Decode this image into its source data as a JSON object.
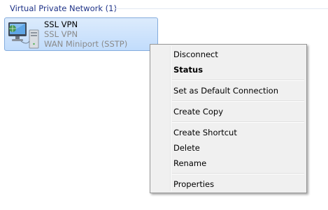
{
  "group": {
    "title": "Virtual Private Network (1)"
  },
  "connection": {
    "name": "SSL VPN",
    "status": "SSL VPN",
    "device": "WAN Miniport (SSTP)",
    "icon": "network-computer-icon"
  },
  "context_menu": {
    "items": [
      {
        "label": "Disconnect",
        "bold": false
      },
      {
        "label": "Status",
        "bold": true
      },
      {
        "label": "Set as Default Connection",
        "bold": false
      },
      {
        "label": "Create Copy",
        "bold": false
      },
      {
        "label": "Create Shortcut",
        "bold": false
      },
      {
        "label": "Delete",
        "bold": false
      },
      {
        "label": "Rename",
        "bold": false
      },
      {
        "label": "Properties",
        "bold": false
      }
    ]
  },
  "colors": {
    "group_header": "#1e3287",
    "selection_border": "#84acdd",
    "menu_background": "#f0f0f0"
  }
}
